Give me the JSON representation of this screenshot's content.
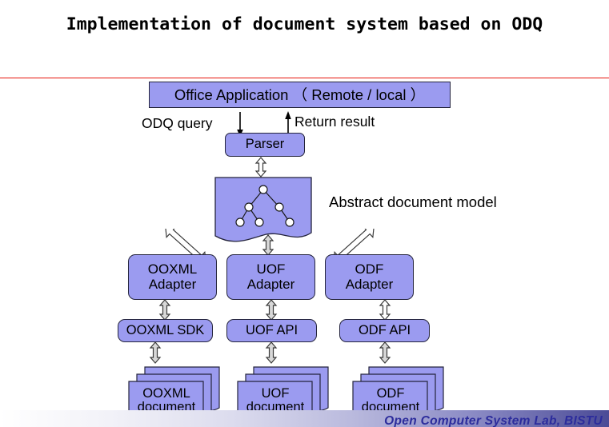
{
  "slide": {
    "title": "Implementation of document system based on ODQ",
    "accent_rule_color": "#e8160c",
    "box_fill_color": "#9b9bf0",
    "box_border_color": "#24243c"
  },
  "diagram": {
    "office_application": "Office Application （ Remote / local ）",
    "parser": "Parser",
    "flow_labels": {
      "odq_query": "ODQ query",
      "return_result": "Return result"
    },
    "model_label": "Abstract document model",
    "adapters": [
      {
        "line1": "OOXML",
        "line2": "Adapter"
      },
      {
        "line1": "UOF",
        "line2": "Adapter"
      },
      {
        "line1": "ODF",
        "line2": "Adapter"
      }
    ],
    "apis": [
      {
        "label": "OOXML SDK"
      },
      {
        "label": "UOF API"
      },
      {
        "label": "ODF API"
      }
    ],
    "documents": [
      {
        "line1": "OOXML",
        "line2": "document"
      },
      {
        "line1": "UOF",
        "line2": "document"
      },
      {
        "line1": "ODF",
        "line2": "document"
      }
    ]
  },
  "footer": {
    "text": "Open Computer System Lab, BISTU"
  }
}
